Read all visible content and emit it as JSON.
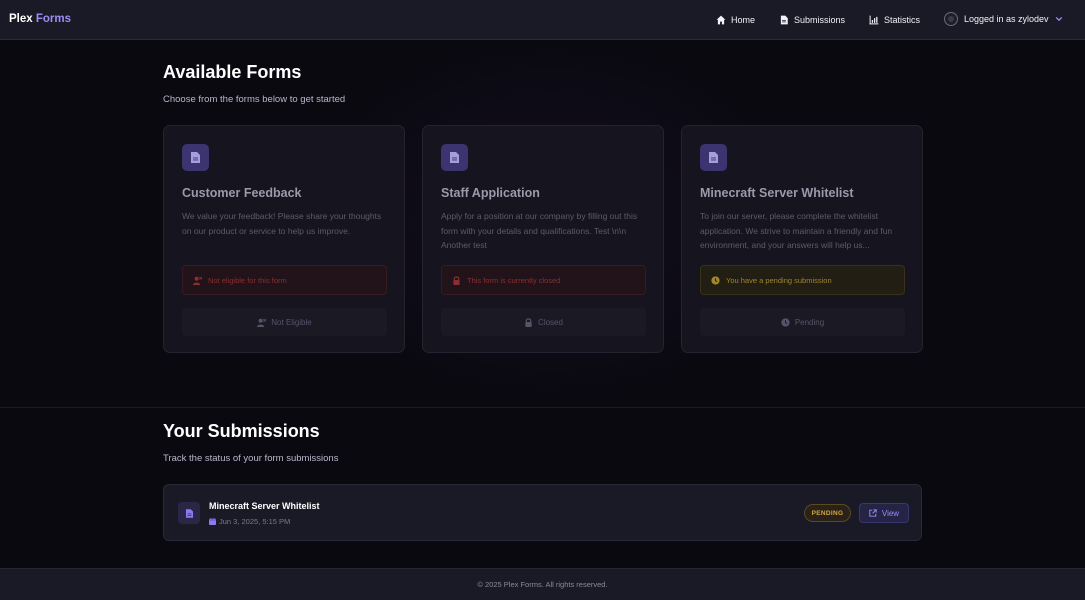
{
  "nav": {
    "brand_part1": "Plex",
    "brand_part2": "Forms",
    "items": [
      {
        "label": "Home",
        "icon": "home-icon"
      },
      {
        "label": "Submissions",
        "icon": "file-icon"
      },
      {
        "label": "Statistics",
        "icon": "chart-icon"
      }
    ],
    "user_label": "Logged in as zylodev"
  },
  "forms_section": {
    "title": "Available Forms",
    "subtitle": "Choose from the forms below to get started",
    "cards": [
      {
        "title": "Customer Feedback",
        "description": "We value your feedback! Please share your thoughts on our product or service to help us improve.",
        "status_text": "Not eligible for this form",
        "status_icon": "user-x-icon",
        "status_color": "#8a3030",
        "button_label": "Not Eligible",
        "button_icon": "user-x-icon"
      },
      {
        "title": "Staff Application",
        "description": "Apply for a position at our company by filling out this form with your details and qualifications. Test \\n\\n Another test",
        "status_text": "This form is currently closed",
        "status_icon": "lock-icon",
        "status_color": "#8a3030",
        "button_label": "Closed",
        "button_icon": "lock-icon"
      },
      {
        "title": "Minecraft Server Whitelist",
        "description": "To join our server, please complete the whitelist application. We strive to maintain a friendly and fun environment, and your answers will help us...",
        "status_text": "You have a pending submission",
        "status_icon": "clock-icon",
        "status_color": "#a08630",
        "button_label": "Pending",
        "button_icon": "clock-icon"
      }
    ]
  },
  "submissions_section": {
    "title": "Your Submissions",
    "subtitle": "Track the status of your form submissions",
    "items": [
      {
        "title": "Minecraft Server Whitelist",
        "date": "Jun 3, 2025, 5:15 PM",
        "status": "PENDING",
        "action_label": "View"
      }
    ]
  },
  "footer": {
    "text": "© 2025 Plex Forms. All rights reserved."
  },
  "colors": {
    "accent": "#9d8cf5",
    "background": "#0a0910",
    "pending": "#d4a642",
    "danger": "#8a3030"
  }
}
